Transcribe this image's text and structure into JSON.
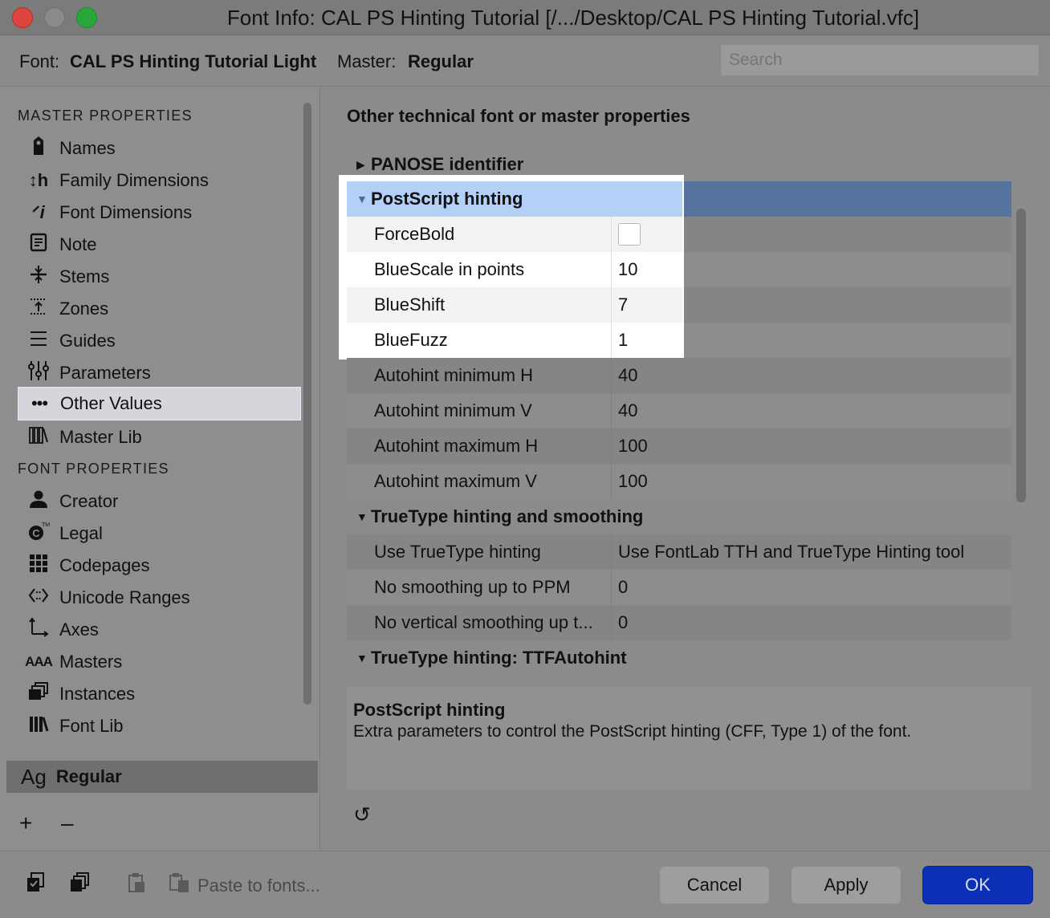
{
  "window": {
    "title": "Font Info: CAL PS Hinting Tutorial [/.../Desktop/CAL PS Hinting Tutorial.vfc]"
  },
  "infobar": {
    "font_label": "Font:",
    "font_value": "CAL PS Hinting Tutorial Light",
    "master_label": "Master:",
    "master_value": "Regular",
    "search_placeholder": "Search"
  },
  "sidebar": {
    "master_header": "MASTER PROPERTIES",
    "master_items": [
      {
        "label": "Names",
        "icon": "tag-icon"
      },
      {
        "label": "Family Dimensions",
        "icon": "family-dimensions-icon"
      },
      {
        "label": "Font Dimensions",
        "icon": "font-dimensions-icon"
      },
      {
        "label": "Note",
        "icon": "note-icon"
      },
      {
        "label": "Stems",
        "icon": "stems-icon"
      },
      {
        "label": "Zones",
        "icon": "zones-icon"
      },
      {
        "label": "Guides",
        "icon": "guides-icon"
      },
      {
        "label": "Parameters",
        "icon": "parameters-icon"
      },
      {
        "label": "Other Values",
        "icon": "ellipsis-icon"
      },
      {
        "label": "Master Lib",
        "icon": "library-icon"
      }
    ],
    "font_header": "FONT PROPERTIES",
    "font_items": [
      {
        "label": "Creator",
        "icon": "person-icon"
      },
      {
        "label": "Legal",
        "icon": "copyright-icon"
      },
      {
        "label": "Codepages",
        "icon": "grid-icon"
      },
      {
        "label": "Unicode Ranges",
        "icon": "unicode-ranges-icon"
      },
      {
        "label": "Axes",
        "icon": "axes-icon"
      },
      {
        "label": "Masters",
        "icon": "masters-icon"
      },
      {
        "label": "Instances",
        "icon": "instances-icon"
      },
      {
        "label": "Font Lib",
        "icon": "library-icon"
      }
    ],
    "selected": "Other Values",
    "master_list": {
      "glyph": "Ag",
      "name": "Regular"
    },
    "add": "+",
    "remove": "–"
  },
  "main": {
    "heading": "Other technical font or master properties",
    "groups": {
      "panose": {
        "label": "PANOSE identifier",
        "expanded": false
      },
      "postscript": {
        "label": "PostScript hinting",
        "expanded": true,
        "rows": [
          {
            "key": "ForceBold",
            "value": ""
          },
          {
            "key": "BlueScale in points",
            "value": "10"
          },
          {
            "key": "BlueShift",
            "value": "7"
          },
          {
            "key": "BlueFuzz",
            "value": "1"
          },
          {
            "key": "Autohint minimum H",
            "value": "40"
          },
          {
            "key": "Autohint minimum V",
            "value": "40"
          },
          {
            "key": "Autohint maximum H",
            "value": "100"
          },
          {
            "key": "Autohint maximum V",
            "value": "100"
          }
        ]
      },
      "truetype": {
        "label": "TrueType hinting and smoothing",
        "expanded": true,
        "rows": [
          {
            "key": "Use TrueType hinting",
            "value": "Use FontLab TTH and TrueType Hinting tool"
          },
          {
            "key": "No smoothing up to PPM",
            "value": "0"
          },
          {
            "key": "No vertical smoothing up t...",
            "value": "0"
          }
        ]
      },
      "ttfautohint": {
        "label": "TrueType hinting: TTFAutohint",
        "expanded": true
      }
    },
    "description": {
      "title": "PostScript hinting",
      "text": "Extra parameters to control the PostScript hinting (CFF, Type 1) of the font."
    }
  },
  "bottom": {
    "paste_label": "Paste to fonts...",
    "cancel": "Cancel",
    "apply": "Apply",
    "ok": "OK"
  },
  "colors": {
    "selection_blue": "#54739d",
    "highlight_header": "#b3d0f7",
    "ok_button": "#0b2fb5"
  }
}
